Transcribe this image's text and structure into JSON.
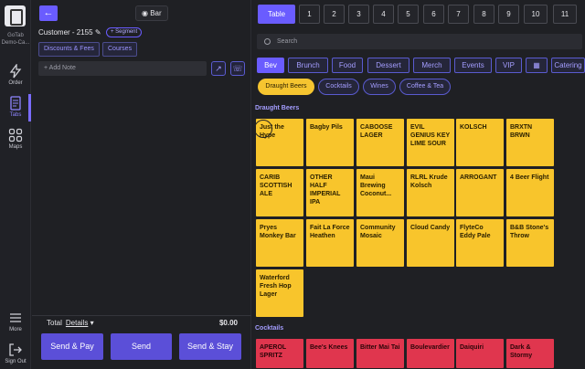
{
  "rail": {
    "org": "GoTab Demo-Ca...",
    "nav": [
      {
        "label": "Order"
      },
      {
        "label": "Tabs"
      },
      {
        "label": "Maps"
      },
      {
        "label": "More"
      },
      {
        "label": "Sign Out"
      }
    ]
  },
  "order": {
    "location": "Bar",
    "customer": "Customer - 2155",
    "segment": "+ Segment",
    "discounts": "Discounts & Fees",
    "courses": "Courses",
    "note_placeholder": "Add Note",
    "total_label": "Total",
    "details_label": "Details",
    "total_value": "$0.00",
    "actions": [
      "Send & Pay",
      "Send",
      "Send & Stay"
    ]
  },
  "menu": {
    "table_label": "Table",
    "tables": [
      "1",
      "2",
      "3",
      "4",
      "5",
      "6",
      "7",
      "8",
      "9",
      "10",
      "11"
    ],
    "search_placeholder": "Search",
    "categories": [
      "Bev",
      "Brunch",
      "Food",
      "Dessert",
      "Merch",
      "Events",
      "VIP",
      "",
      "Catering"
    ],
    "subcategories": [
      "Draught Beers",
      "Cocktails",
      "Wines",
      "Coffee & Tea"
    ],
    "section_draught": "Draught Beers",
    "section_cocktails": "Cocktails",
    "draught_items": [
      "Just the Hype",
      "Bagby Pils",
      "CABOOSE LAGER",
      "EVIL GENIUS KEY LIME SOUR",
      "KOLSCH",
      "BRXTN BRWN",
      "CARIB SCOTTISH ALE",
      "OTHER HALF IMPERIAL IPA",
      "Maui Brewing Coconut...",
      "RLRL Krude Kolsch",
      "ARROGANT",
      "4 Beer Flight",
      "Pryes Monkey Bar",
      "Fait La Force Heathen",
      "Community Mosaic",
      "Cloud Candy",
      "FlyteCo Eddy Pale",
      "B&B Stone's Throw",
      "Waterford Fresh Hop Lager"
    ],
    "cocktail_items": [
      "APEROL SPRITZ",
      "Bee's Knees",
      "Bitter Mai Tai",
      "Boulevardier",
      "Daiquiri",
      "Dark & Stormy"
    ]
  },
  "colors": {
    "accent": "#6a5cff",
    "beer_tile": "#f8c52c",
    "cocktail_tile": "#e0364e",
    "bg": "#1f2024"
  }
}
